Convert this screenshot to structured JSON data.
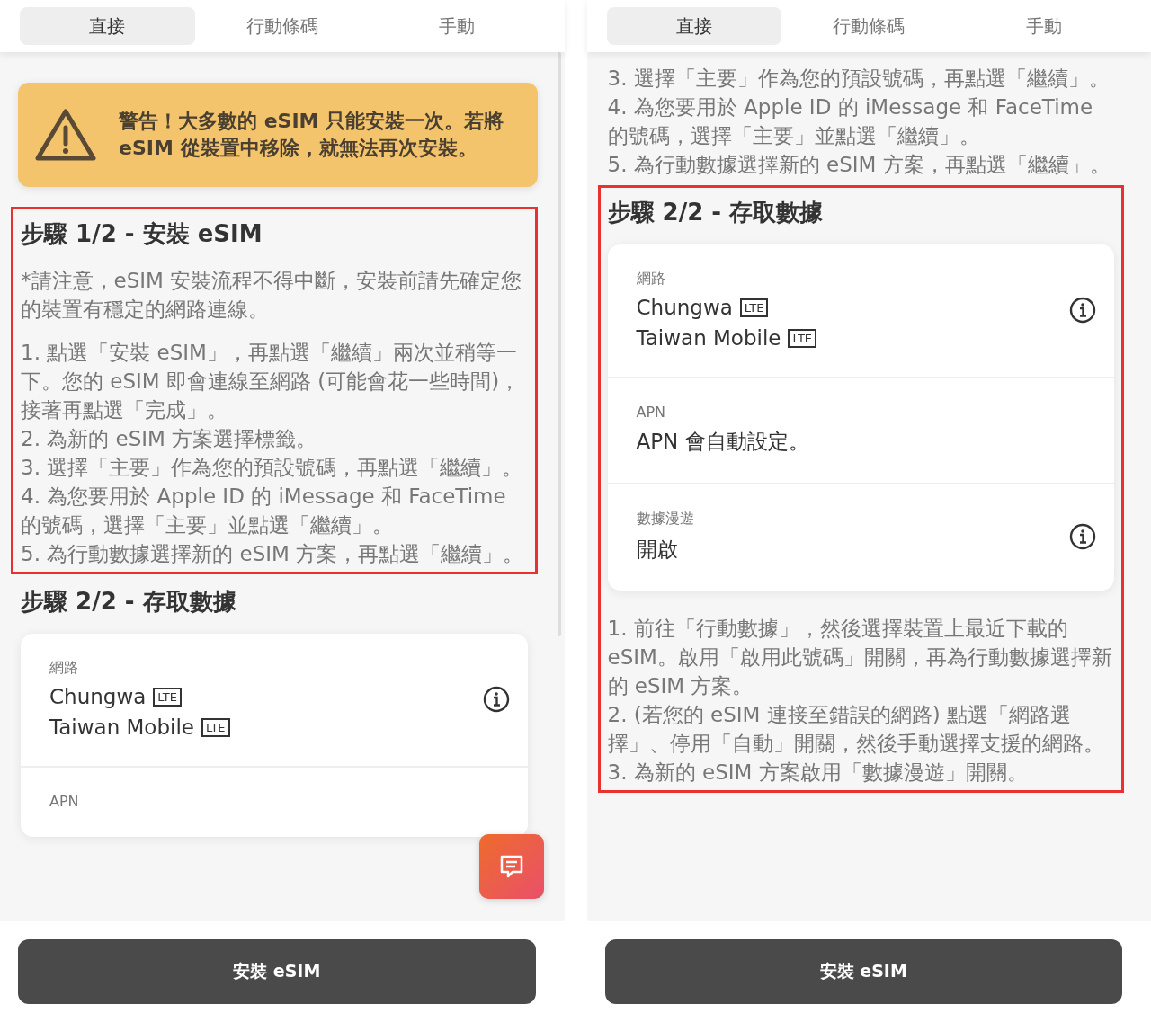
{
  "panels": [
    {
      "tabs": [
        {
          "label": "直接",
          "selected": true
        },
        {
          "label": "行動條碼",
          "selected": false
        },
        {
          "label": "手動",
          "selected": false
        }
      ],
      "scrollbar": true,
      "blocks": [
        {
          "kind": "warning",
          "text": "警告！大多數的 eSIM 只能安裝一次。若將 eSIM 從裝置中移除，就無法再次安裝。"
        },
        {
          "kind": "section",
          "highlighted": true,
          "parts": [
            {
              "kind": "title",
              "text": "步驟 1/2 - 安裝 eSIM"
            },
            {
              "kind": "note",
              "text": "*請注意，eSIM 安裝流程不得中斷，安裝前請先確定您的裝置有穩定的網路連線。"
            },
            {
              "kind": "steps",
              "items": [
                "1. 點選「安裝 eSIM」，再點選「繼續」兩次並稍等一下。您的 eSIM 即會連線至網路 (可能會花一些時間)，接著再點選「完成」。",
                "2. 為新的 eSIM 方案選擇標籤。",
                "3. 選擇「主要」作為您的預設號碼，再點選「繼續」。",
                "4. 為您要用於 Apple ID 的 iMessage 和 FaceTime 的號碼，選擇「主要」並點選「繼續」。",
                "5. 為行動數據選擇新的 eSIM 方案，再點選「繼續」。"
              ]
            }
          ]
        },
        {
          "kind": "section",
          "highlighted": false,
          "parts": [
            {
              "kind": "title",
              "text": "步驟 2/2 - 存取數據"
            },
            {
              "kind": "card",
              "rows": [
                {
                  "label": "網路",
                  "values": [
                    {
                      "text": "Chungwa",
                      "badge": "LTE"
                    },
                    {
                      "text": "Taiwan Mobile",
                      "badge": "LTE"
                    }
                  ],
                  "info": true
                },
                {
                  "label": "APN",
                  "values": [],
                  "info": false
                }
              ]
            }
          ]
        }
      ],
      "chat_button": true,
      "install_button": "安裝 eSIM"
    },
    {
      "tabs": [
        {
          "label": "直接",
          "selected": true
        },
        {
          "label": "行動條碼",
          "selected": false
        },
        {
          "label": "手動",
          "selected": false
        }
      ],
      "scrollbar": false,
      "blocks": [
        {
          "kind": "section",
          "highlighted": false,
          "parts": [
            {
              "kind": "steps",
              "items": [
                "3. 選擇「主要」作為您的預設號碼，再點選「繼續」。",
                "4. 為您要用於 Apple ID 的 iMessage 和 FaceTime 的號碼，選擇「主要」並點選「繼續」。",
                "5. 為行動數據選擇新的 eSIM 方案，再點選「繼續」。"
              ]
            }
          ]
        },
        {
          "kind": "section",
          "highlighted": true,
          "parts": [
            {
              "kind": "title",
              "text": "步驟 2/2 - 存取數據"
            },
            {
              "kind": "card",
              "rows": [
                {
                  "label": "網路",
                  "values": [
                    {
                      "text": "Chungwa",
                      "badge": "LTE"
                    },
                    {
                      "text": "Taiwan Mobile",
                      "badge": "LTE"
                    }
                  ],
                  "info": true
                },
                {
                  "label": "APN",
                  "values": [
                    {
                      "text": "APN 會自動設定。"
                    }
                  ],
                  "info": false
                },
                {
                  "label": "數據漫遊",
                  "values": [
                    {
                      "text": "開啟"
                    }
                  ],
                  "info": true
                }
              ]
            },
            {
              "kind": "steps",
              "items": [
                "1. 前往「行動數據」，然後選擇裝置上最近下載的 eSIM。啟用「啟用此號碼」開關，再為行動數據選擇新的 eSIM 方案。",
                "2. (若您的 eSIM 連接至錯誤的網路) 點選「網路選擇」、停用「自動」開關，然後手動選擇支援的網路。",
                "3. 為新的 eSIM 方案啟用「數據漫遊」開關。"
              ]
            }
          ]
        }
      ],
      "chat_button": false,
      "install_button": "安裝 eSIM"
    }
  ]
}
